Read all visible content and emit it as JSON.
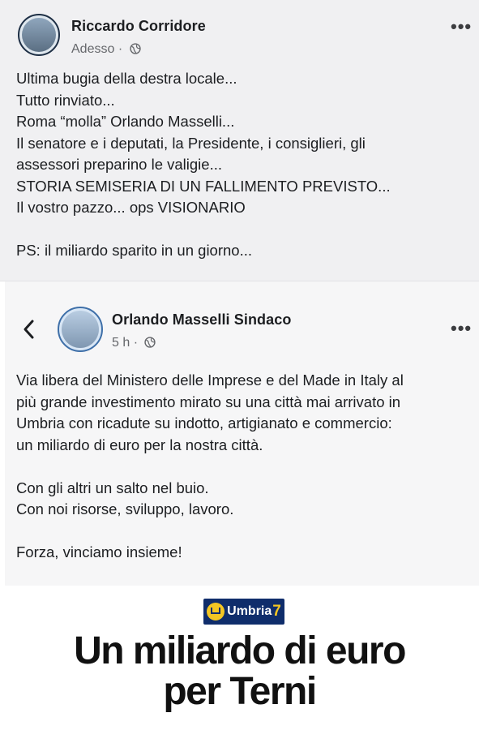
{
  "post1": {
    "author": "Riccardo Corridore",
    "time": "Adesso",
    "separator": "·",
    "text": "Ultima bugia della destra locale...\nTutto rinviato...\nRoma “molla” Orlando Masselli...\nIl senatore e i deputati, la Presidente, i consiglieri, gli\nassessori preparino le valigie...\nSTORIA SEMISERIA DI UN FALLIMENTO PREVISTO...\nIl vostro pazzo... ops VISIONARIO\n\nPS: il miliardo sparito in un giorno...",
    "more_label": "•••"
  },
  "post2": {
    "author": "Orlando Masselli Sindaco",
    "time": "5 h",
    "separator": "·",
    "more_label": "•••",
    "text": "Via libera del Ministero delle Imprese e del Made in Italy al\npiù grande investimento mirato su una città mai arrivato in\nUmbria con ricadute su indotto, artigianato e commercio:\nun miliardo di euro per la nostra città.\n\nCon gli altri un salto nel buio.\nCon noi risorse, sviluppo, lavoro.\n\nForza, vinciamo insieme!",
    "image": {
      "logo_text": "Umbria",
      "logo_number": "7",
      "headline_line1": "Un miliardo di euro",
      "headline_line2": "per Terni"
    }
  },
  "icons": {
    "audience": "globe-icon",
    "back": "chevron-left-icon",
    "more": "more-dots-icon"
  },
  "colors": {
    "logo_bg": "#0f2d6b",
    "logo_accent": "#f3c623",
    "secondary_text": "#65676b"
  }
}
